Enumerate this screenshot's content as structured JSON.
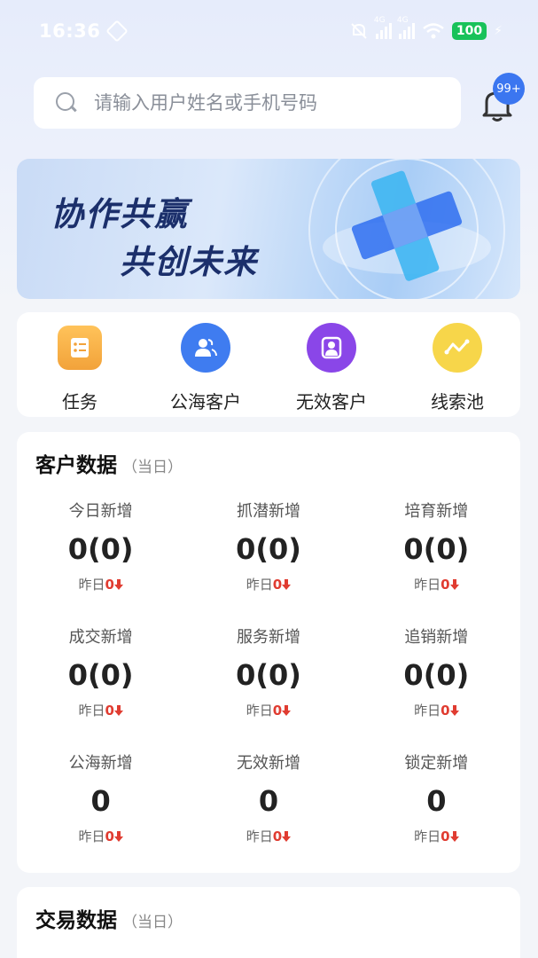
{
  "status_bar": {
    "time": "16:36",
    "battery": "100",
    "net1": "4G",
    "net2": "4G"
  },
  "search": {
    "placeholder": "请输入用户姓名或手机号码"
  },
  "notifications": {
    "badge": "99+"
  },
  "banner": {
    "line1": "协作共赢",
    "line2": "共创未来"
  },
  "quick_nav": [
    {
      "label": "任务",
      "icon": "task-list-icon"
    },
    {
      "label": "公海客户",
      "icon": "users-icon"
    },
    {
      "label": "无效客户",
      "icon": "person-frame-icon"
    },
    {
      "label": "线索池",
      "icon": "trend-line-icon"
    }
  ],
  "customer_data": {
    "title": "客户数据",
    "subtitle": "（当日）",
    "yesterday_prefix": "昨日",
    "stats": [
      {
        "label": "今日新增",
        "value": "0(0)",
        "yesterday": "0"
      },
      {
        "label": "抓潜新增",
        "value": "0(0)",
        "yesterday": "0"
      },
      {
        "label": "培育新增",
        "value": "0(0)",
        "yesterday": "0"
      },
      {
        "label": "成交新增",
        "value": "0(0)",
        "yesterday": "0"
      },
      {
        "label": "服务新增",
        "value": "0(0)",
        "yesterday": "0"
      },
      {
        "label": "追销新增",
        "value": "0(0)",
        "yesterday": "0"
      },
      {
        "label": "公海新增",
        "value": "0",
        "yesterday": "0"
      },
      {
        "label": "无效新增",
        "value": "0",
        "yesterday": "0"
      },
      {
        "label": "锁定新增",
        "value": "0",
        "yesterday": "0"
      }
    ]
  },
  "trade_data": {
    "title": "交易数据",
    "subtitle": "（当日）"
  },
  "colors": {
    "accent": "#3b76f0",
    "down": "#e03c31",
    "battery": "#19c25a"
  }
}
